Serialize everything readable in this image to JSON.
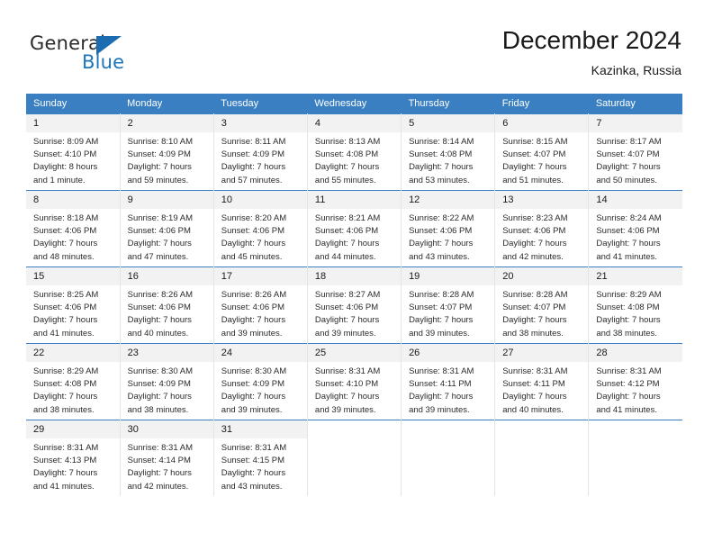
{
  "brand": {
    "name_top": "General",
    "name_bottom": "Blue",
    "accent_color": "#1b76bc",
    "triangle_color": "#1b6cb0"
  },
  "header": {
    "title": "December 2024",
    "subtitle": "Kazinka, Russia",
    "header_bg_color": "#3a7fc1",
    "daynum_bg_color": "#f2f2f2"
  },
  "weekday_headers": [
    "Sunday",
    "Monday",
    "Tuesday",
    "Wednesday",
    "Thursday",
    "Friday",
    "Saturday"
  ],
  "weeks": [
    [
      {
        "day": "1",
        "sunrise": "Sunrise: 8:09 AM",
        "sunset": "Sunset: 4:10 PM",
        "daylight1": "Daylight: 8 hours",
        "daylight2": "and 1 minute."
      },
      {
        "day": "2",
        "sunrise": "Sunrise: 8:10 AM",
        "sunset": "Sunset: 4:09 PM",
        "daylight1": "Daylight: 7 hours",
        "daylight2": "and 59 minutes."
      },
      {
        "day": "3",
        "sunrise": "Sunrise: 8:11 AM",
        "sunset": "Sunset: 4:09 PM",
        "daylight1": "Daylight: 7 hours",
        "daylight2": "and 57 minutes."
      },
      {
        "day": "4",
        "sunrise": "Sunrise: 8:13 AM",
        "sunset": "Sunset: 4:08 PM",
        "daylight1": "Daylight: 7 hours",
        "daylight2": "and 55 minutes."
      },
      {
        "day": "5",
        "sunrise": "Sunrise: 8:14 AM",
        "sunset": "Sunset: 4:08 PM",
        "daylight1": "Daylight: 7 hours",
        "daylight2": "and 53 minutes."
      },
      {
        "day": "6",
        "sunrise": "Sunrise: 8:15 AM",
        "sunset": "Sunset: 4:07 PM",
        "daylight1": "Daylight: 7 hours",
        "daylight2": "and 51 minutes."
      },
      {
        "day": "7",
        "sunrise": "Sunrise: 8:17 AM",
        "sunset": "Sunset: 4:07 PM",
        "daylight1": "Daylight: 7 hours",
        "daylight2": "and 50 minutes."
      }
    ],
    [
      {
        "day": "8",
        "sunrise": "Sunrise: 8:18 AM",
        "sunset": "Sunset: 4:06 PM",
        "daylight1": "Daylight: 7 hours",
        "daylight2": "and 48 minutes."
      },
      {
        "day": "9",
        "sunrise": "Sunrise: 8:19 AM",
        "sunset": "Sunset: 4:06 PM",
        "daylight1": "Daylight: 7 hours",
        "daylight2": "and 47 minutes."
      },
      {
        "day": "10",
        "sunrise": "Sunrise: 8:20 AM",
        "sunset": "Sunset: 4:06 PM",
        "daylight1": "Daylight: 7 hours",
        "daylight2": "and 45 minutes."
      },
      {
        "day": "11",
        "sunrise": "Sunrise: 8:21 AM",
        "sunset": "Sunset: 4:06 PM",
        "daylight1": "Daylight: 7 hours",
        "daylight2": "and 44 minutes."
      },
      {
        "day": "12",
        "sunrise": "Sunrise: 8:22 AM",
        "sunset": "Sunset: 4:06 PM",
        "daylight1": "Daylight: 7 hours",
        "daylight2": "and 43 minutes."
      },
      {
        "day": "13",
        "sunrise": "Sunrise: 8:23 AM",
        "sunset": "Sunset: 4:06 PM",
        "daylight1": "Daylight: 7 hours",
        "daylight2": "and 42 minutes."
      },
      {
        "day": "14",
        "sunrise": "Sunrise: 8:24 AM",
        "sunset": "Sunset: 4:06 PM",
        "daylight1": "Daylight: 7 hours",
        "daylight2": "and 41 minutes."
      }
    ],
    [
      {
        "day": "15",
        "sunrise": "Sunrise: 8:25 AM",
        "sunset": "Sunset: 4:06 PM",
        "daylight1": "Daylight: 7 hours",
        "daylight2": "and 41 minutes."
      },
      {
        "day": "16",
        "sunrise": "Sunrise: 8:26 AM",
        "sunset": "Sunset: 4:06 PM",
        "daylight1": "Daylight: 7 hours",
        "daylight2": "and 40 minutes."
      },
      {
        "day": "17",
        "sunrise": "Sunrise: 8:26 AM",
        "sunset": "Sunset: 4:06 PM",
        "daylight1": "Daylight: 7 hours",
        "daylight2": "and 39 minutes."
      },
      {
        "day": "18",
        "sunrise": "Sunrise: 8:27 AM",
        "sunset": "Sunset: 4:06 PM",
        "daylight1": "Daylight: 7 hours",
        "daylight2": "and 39 minutes."
      },
      {
        "day": "19",
        "sunrise": "Sunrise: 8:28 AM",
        "sunset": "Sunset: 4:07 PM",
        "daylight1": "Daylight: 7 hours",
        "daylight2": "and 39 minutes."
      },
      {
        "day": "20",
        "sunrise": "Sunrise: 8:28 AM",
        "sunset": "Sunset: 4:07 PM",
        "daylight1": "Daylight: 7 hours",
        "daylight2": "and 38 minutes."
      },
      {
        "day": "21",
        "sunrise": "Sunrise: 8:29 AM",
        "sunset": "Sunset: 4:08 PM",
        "daylight1": "Daylight: 7 hours",
        "daylight2": "and 38 minutes."
      }
    ],
    [
      {
        "day": "22",
        "sunrise": "Sunrise: 8:29 AM",
        "sunset": "Sunset: 4:08 PM",
        "daylight1": "Daylight: 7 hours",
        "daylight2": "and 38 minutes."
      },
      {
        "day": "23",
        "sunrise": "Sunrise: 8:30 AM",
        "sunset": "Sunset: 4:09 PM",
        "daylight1": "Daylight: 7 hours",
        "daylight2": "and 38 minutes."
      },
      {
        "day": "24",
        "sunrise": "Sunrise: 8:30 AM",
        "sunset": "Sunset: 4:09 PM",
        "daylight1": "Daylight: 7 hours",
        "daylight2": "and 39 minutes."
      },
      {
        "day": "25",
        "sunrise": "Sunrise: 8:31 AM",
        "sunset": "Sunset: 4:10 PM",
        "daylight1": "Daylight: 7 hours",
        "daylight2": "and 39 minutes."
      },
      {
        "day": "26",
        "sunrise": "Sunrise: 8:31 AM",
        "sunset": "Sunset: 4:11 PM",
        "daylight1": "Daylight: 7 hours",
        "daylight2": "and 39 minutes."
      },
      {
        "day": "27",
        "sunrise": "Sunrise: 8:31 AM",
        "sunset": "Sunset: 4:11 PM",
        "daylight1": "Daylight: 7 hours",
        "daylight2": "and 40 minutes."
      },
      {
        "day": "28",
        "sunrise": "Sunrise: 8:31 AM",
        "sunset": "Sunset: 4:12 PM",
        "daylight1": "Daylight: 7 hours",
        "daylight2": "and 41 minutes."
      }
    ],
    [
      {
        "day": "29",
        "sunrise": "Sunrise: 8:31 AM",
        "sunset": "Sunset: 4:13 PM",
        "daylight1": "Daylight: 7 hours",
        "daylight2": "and 41 minutes."
      },
      {
        "day": "30",
        "sunrise": "Sunrise: 8:31 AM",
        "sunset": "Sunset: 4:14 PM",
        "daylight1": "Daylight: 7 hours",
        "daylight2": "and 42 minutes."
      },
      {
        "day": "31",
        "sunrise": "Sunrise: 8:31 AM",
        "sunset": "Sunset: 4:15 PM",
        "daylight1": "Daylight: 7 hours",
        "daylight2": "and 43 minutes."
      },
      {
        "day": "",
        "sunrise": "",
        "sunset": "",
        "daylight1": "",
        "daylight2": ""
      },
      {
        "day": "",
        "sunrise": "",
        "sunset": "",
        "daylight1": "",
        "daylight2": ""
      },
      {
        "day": "",
        "sunrise": "",
        "sunset": "",
        "daylight1": "",
        "daylight2": ""
      },
      {
        "day": "",
        "sunrise": "",
        "sunset": "",
        "daylight1": "",
        "daylight2": ""
      }
    ]
  ]
}
